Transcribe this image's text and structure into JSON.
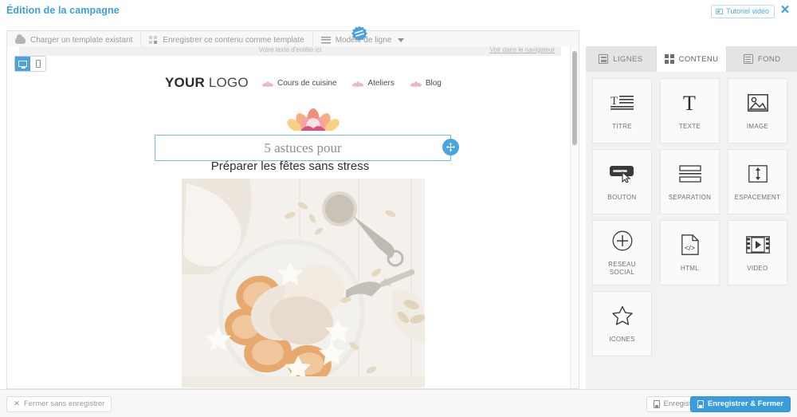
{
  "header": {
    "title": "Édition de la campagne",
    "tutorial_label": "Tutoriel vidéo",
    "close_label": "✕"
  },
  "toolbar": {
    "load_template": "Charger un template existant",
    "save_as_template": "Enregistrer ce contenu comme template",
    "row_model": "Modèle de ligne"
  },
  "device": {
    "desktop": "desktop",
    "mobile": "mobile"
  },
  "email": {
    "preheader_text": "Votre texte d'entête ici",
    "browser_link": "Voir dans le navigateur",
    "logo_bold": "YOUR",
    "logo_light": " LOGO",
    "nav": [
      {
        "label": "Cours de cuisine"
      },
      {
        "label": "Ateliers"
      },
      {
        "label": "Blog"
      }
    ],
    "title_selected": "5 astuces pour",
    "subtitle": "Préparer les fêtes sans stress"
  },
  "panel": {
    "tabs": [
      {
        "label": "LIGNES",
        "active": false
      },
      {
        "label": "CONTENU",
        "active": true
      },
      {
        "label": "FOND",
        "active": false
      }
    ],
    "blocks": [
      {
        "label": "TITRE"
      },
      {
        "label": "TEXTE"
      },
      {
        "label": "IMAGE"
      },
      {
        "label": "BOUTON"
      },
      {
        "label": "SEPARATION"
      },
      {
        "label": "ESPACEMENT"
      },
      {
        "label": "RESEAU\nSOCIAL"
      },
      {
        "label": "HTML"
      },
      {
        "label": "VIDEO"
      },
      {
        "label": "ICONES"
      }
    ]
  },
  "footer": {
    "close_without_save": "Fermer sans enregistrer",
    "save": "Enregistrer",
    "save_and_close": "Enregistrer & Fermer"
  },
  "colors": {
    "accent": "#3c9fdc",
    "primary_button": "#399ddd",
    "selection_border": "#7ab9e0"
  }
}
